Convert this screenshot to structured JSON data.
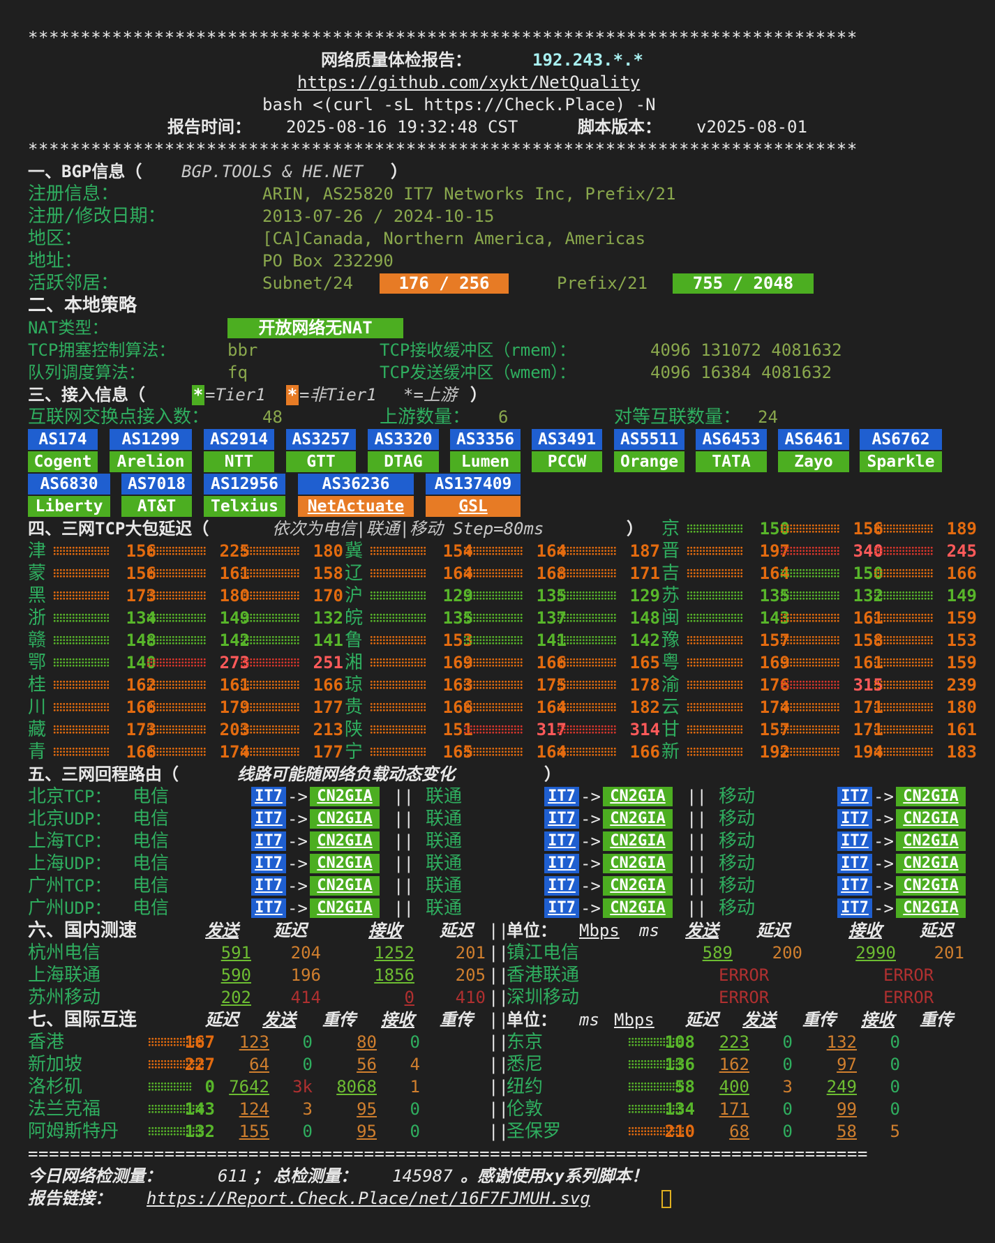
{
  "stars": "*******************************************************************************",
  "header": {
    "title": "网络质量体检报告：",
    "ip": "192.243.*.*",
    "repo_url": "https://github.com/xykt/NetQuality",
    "command": "bash <(curl -sL https://Check.Place) -N",
    "time_label": "报告时间：",
    "time_value": "2025-08-16 19:32:48 CST",
    "version_label": "脚本版本：",
    "version_value": "v2025-08-01"
  },
  "s1": {
    "title": "一、BGP信息（",
    "title_src": "BGP.TOOLS & HE.NET",
    "title_end": "）",
    "reg_label": "注册信息：",
    "reg_value": "ARIN, AS25820 IT7 Networks Inc, Prefix/21",
    "date_label": "注册/修改日期：",
    "date_value": "2013-07-26 / 2024-10-15",
    "region_label": "地区：",
    "region_value": "[CA]Canada, Northern America, Americas",
    "addr_label": "地址：",
    "addr_value": "PO Box 232290",
    "neighbor_label": "活跃邻居：",
    "subnet_label": "Subnet/24",
    "subnet_value": " 176 / 256 ",
    "prefix_label": "Prefix/21",
    "prefix_value": " 755 / 2048 "
  },
  "s2": {
    "title": "二、本地策略",
    "nat_label": "NAT类型：",
    "nat_value": "开放网络无NAT",
    "cc_label": "TCP拥塞控制算法：",
    "cc_value": "bbr",
    "rmem_label": "TCP接收缓冲区（rmem）：",
    "rmem_value": "4096 131072 4081632",
    "qd_label": "队列调度算法：",
    "qd_value": "fq",
    "wmem_label": "TCP发送缓冲区（wmem）：",
    "wmem_value": "4096 16384 4081632"
  },
  "s3": {
    "title": "三、接入信息（",
    "legend_tier1": "=Tier1 ",
    "legend_non": "=非Tier1 ",
    "legend_up": "*=上游",
    "legend_end": "）",
    "ix_label": "互联网交换点接入数：",
    "ix_value": "48",
    "up_label": "上游数量：",
    "up_value": "6",
    "peer_label": "对等互联数量：",
    "peer_value": "24",
    "asns": [
      {
        "as": "AS174",
        "name": "Cogent",
        "color": "#4cae21"
      },
      {
        "as": "AS1299",
        "name": "Arelion",
        "color": "#4cae21"
      },
      {
        "as": "AS2914",
        "name": "NTT",
        "color": "#4cae21"
      },
      {
        "as": "AS3257",
        "name": "GTT",
        "color": "#4cae21"
      },
      {
        "as": "AS3320",
        "name": "DTAG",
        "color": "#4cae21"
      },
      {
        "as": "AS3356",
        "name": "Lumen",
        "color": "#4cae21"
      },
      {
        "as": "AS3491",
        "name": "PCCW",
        "color": "#4cae21"
      },
      {
        "as": "AS5511",
        "name": "Orange",
        "color": "#4cae21"
      },
      {
        "as": "AS6453",
        "name": "TATA",
        "color": "#4cae21"
      },
      {
        "as": "AS6461",
        "name": "Zayo",
        "color": "#4cae21"
      },
      {
        "as": "AS6762",
        "name": "Sparkle",
        "color": "#4cae21"
      },
      {
        "as": "AS6830",
        "name": "Liberty",
        "color": "#4cae21"
      },
      {
        "as": "AS7018",
        "name": "AT&T",
        "color": "#4cae21"
      },
      {
        "as": "AS12956",
        "name": "Telxius",
        "color": "#4cae21"
      },
      {
        "as": "AS36236",
        "name": "NetActuate",
        "color": "#e77b25"
      },
      {
        "as": "AS137409",
        "name": "GSL",
        "color": "#e77b25"
      }
    ]
  },
  "s4": {
    "title": "四、三网TCP大包延迟（",
    "title_i": "依次为电信|联通|移动 Step=80ms",
    "title_end": "）",
    "rows": [
      [
        {
          "p": "京",
          "v": [
            150,
            156,
            189
          ]
        }
      ],
      [
        {
          "p": "津",
          "v": [
            156,
            225,
            180
          ]
        },
        {
          "p": "冀",
          "v": [
            154,
            164,
            187
          ]
        },
        {
          "p": "晋",
          "v": [
            197,
            340,
            245
          ]
        }
      ],
      [
        {
          "p": "蒙",
          "v": [
            156,
            161,
            158
          ]
        },
        {
          "p": "辽",
          "v": [
            164,
            168,
            171
          ]
        },
        {
          "p": "吉",
          "v": [
            164,
            150,
            166
          ]
        }
      ],
      [
        {
          "p": "黑",
          "v": [
            173,
            180,
            170
          ]
        },
        {
          "p": "沪",
          "v": [
            129,
            135,
            129
          ]
        },
        {
          "p": "苏",
          "v": [
            135,
            132,
            149
          ]
        }
      ],
      [
        {
          "p": "浙",
          "v": [
            134,
            149,
            132
          ]
        },
        {
          "p": "皖",
          "v": [
            135,
            137,
            148
          ]
        },
        {
          "p": "闽",
          "v": [
            143,
            161,
            159
          ]
        }
      ],
      [
        {
          "p": "赣",
          "v": [
            148,
            142,
            141
          ]
        },
        {
          "p": "鲁",
          "v": [
            153,
            141,
            142
          ]
        },
        {
          "p": "豫",
          "v": [
            157,
            158,
            153
          ]
        }
      ],
      [
        {
          "p": "鄂",
          "v": [
            140,
            273,
            251
          ]
        },
        {
          "p": "湘",
          "v": [
            169,
            166,
            165
          ]
        },
        {
          "p": "粤",
          "v": [
            169,
            161,
            159
          ]
        }
      ],
      [
        {
          "p": "桂",
          "v": [
            162,
            161,
            166
          ]
        },
        {
          "p": "琼",
          "v": [
            163,
            175,
            178
          ]
        },
        {
          "p": "渝",
          "v": [
            176,
            315,
            239
          ]
        }
      ],
      [
        {
          "p": "川",
          "v": [
            166,
            179,
            177
          ]
        },
        {
          "p": "贵",
          "v": [
            166,
            164,
            182
          ]
        },
        {
          "p": "云",
          "v": [
            174,
            171,
            180
          ]
        }
      ],
      [
        {
          "p": "藏",
          "v": [
            173,
            203,
            213
          ]
        },
        {
          "p": "陕",
          "v": [
            151,
            317,
            314
          ]
        },
        {
          "p": "甘",
          "v": [
            157,
            171,
            161
          ]
        }
      ],
      [
        {
          "p": "青",
          "v": [
            166,
            174,
            177
          ]
        },
        {
          "p": "宁",
          "v": [
            165,
            164,
            166
          ]
        },
        {
          "p": "新",
          "v": [
            192,
            194,
            183
          ]
        }
      ]
    ]
  },
  "s5": {
    "title": "五、三网回程路由（",
    "title_i": "线路可能随网络负载动态变化",
    "title_end": "）",
    "isp1": "电信",
    "isp2": "联通",
    "isp3": "移动",
    "sep": "||",
    "arrow": "->",
    "r1": "IT7",
    "r2": "CN2GIA",
    "rows": [
      {
        "city": "北京",
        "proto": "TCP："
      },
      {
        "city": "北京",
        "proto": "UDP："
      },
      {
        "city": "上海",
        "proto": "TCP："
      },
      {
        "city": "上海",
        "proto": "UDP："
      },
      {
        "city": "广州",
        "proto": "TCP："
      },
      {
        "city": "广州",
        "proto": "UDP："
      }
    ]
  },
  "s6": {
    "title": "六、国内测速",
    "h_send": "发送",
    "h_lat": "延迟",
    "h_recv": "接收",
    "h_lat2": "延迟",
    "unit_label": "单位：",
    "unit_mbps": "Mbps",
    "unit_ms": "ms",
    "left": [
      {
        "name": "杭州电信",
        "send": "591",
        "lat": "204",
        "recv": "1252",
        "lat2": "201"
      },
      {
        "name": "上海联通",
        "send": "590",
        "lat": "196",
        "recv": "1856",
        "lat2": "205"
      },
      {
        "name": "苏州移动",
        "send": "202",
        "lat": "414",
        "recv": "0",
        "lat2": "410"
      }
    ],
    "right": [
      {
        "name": "镇江电信",
        "send": "589",
        "lat": "200",
        "recv": "2990",
        "lat2": "201"
      },
      {
        "name": "香港联通",
        "err1": "ERROR",
        "err2": "ERROR"
      },
      {
        "name": "深圳移动",
        "err1": "ERROR",
        "err2": "ERROR"
      }
    ]
  },
  "s7": {
    "title": "七、国际互连",
    "h_lat": "延迟",
    "h_send": "发送",
    "h_retx": "重传",
    "h_recv": "接收",
    "h_retx2": "重传",
    "unit_label": "单位：",
    "unit_ms": "ms",
    "unit_mbps": "Mbps",
    "left": [
      {
        "name": "香港",
        "lat": "167",
        "send": "123",
        "r1": "0",
        "recv": "80",
        "r2": "0"
      },
      {
        "name": "新加坡",
        "lat": "227",
        "send": "64",
        "r1": "0",
        "recv": "56",
        "r2": "4"
      },
      {
        "name": "洛杉矶",
        "lat": "0",
        "send": "7642",
        "r1": "3k",
        "recv": "8068",
        "r2": "1"
      },
      {
        "name": "法兰克福",
        "lat": "143",
        "send": "124",
        "r1": "3",
        "recv": "95",
        "r2": "0"
      },
      {
        "name": "阿姆斯特丹",
        "lat": "132",
        "send": "155",
        "r1": "0",
        "recv": "95",
        "r2": "0"
      }
    ],
    "right": [
      {
        "name": "东京",
        "lat": "108",
        "send": "223",
        "r1": "0",
        "recv": "132",
        "r2": "0"
      },
      {
        "name": "悉尼",
        "lat": "136",
        "send": "162",
        "r1": "0",
        "recv": "97",
        "r2": "0"
      },
      {
        "name": "纽约",
        "lat": "58",
        "send": "400",
        "r1": "3",
        "recv": "249",
        "r2": "0"
      },
      {
        "name": "伦敦",
        "lat": "134",
        "send": "171",
        "r1": "0",
        "recv": "99",
        "r2": "0"
      },
      {
        "name": "圣保罗",
        "lat": "210",
        "send": "68",
        "r1": "0",
        "recv": "58",
        "r2": "5"
      }
    ]
  },
  "equals": "================================================================================",
  "footer": {
    "today_label": "今日网络检测量：",
    "today_value": "611",
    "sep": "；",
    "total_label": "总检测量：",
    "total_value": "145987",
    "thanks": "。感谢使用xy系列脚本！",
    "link_label": "报告链接：",
    "link_value": "https://Report.Check.Place/net/16F7FJMUH.svg"
  }
}
